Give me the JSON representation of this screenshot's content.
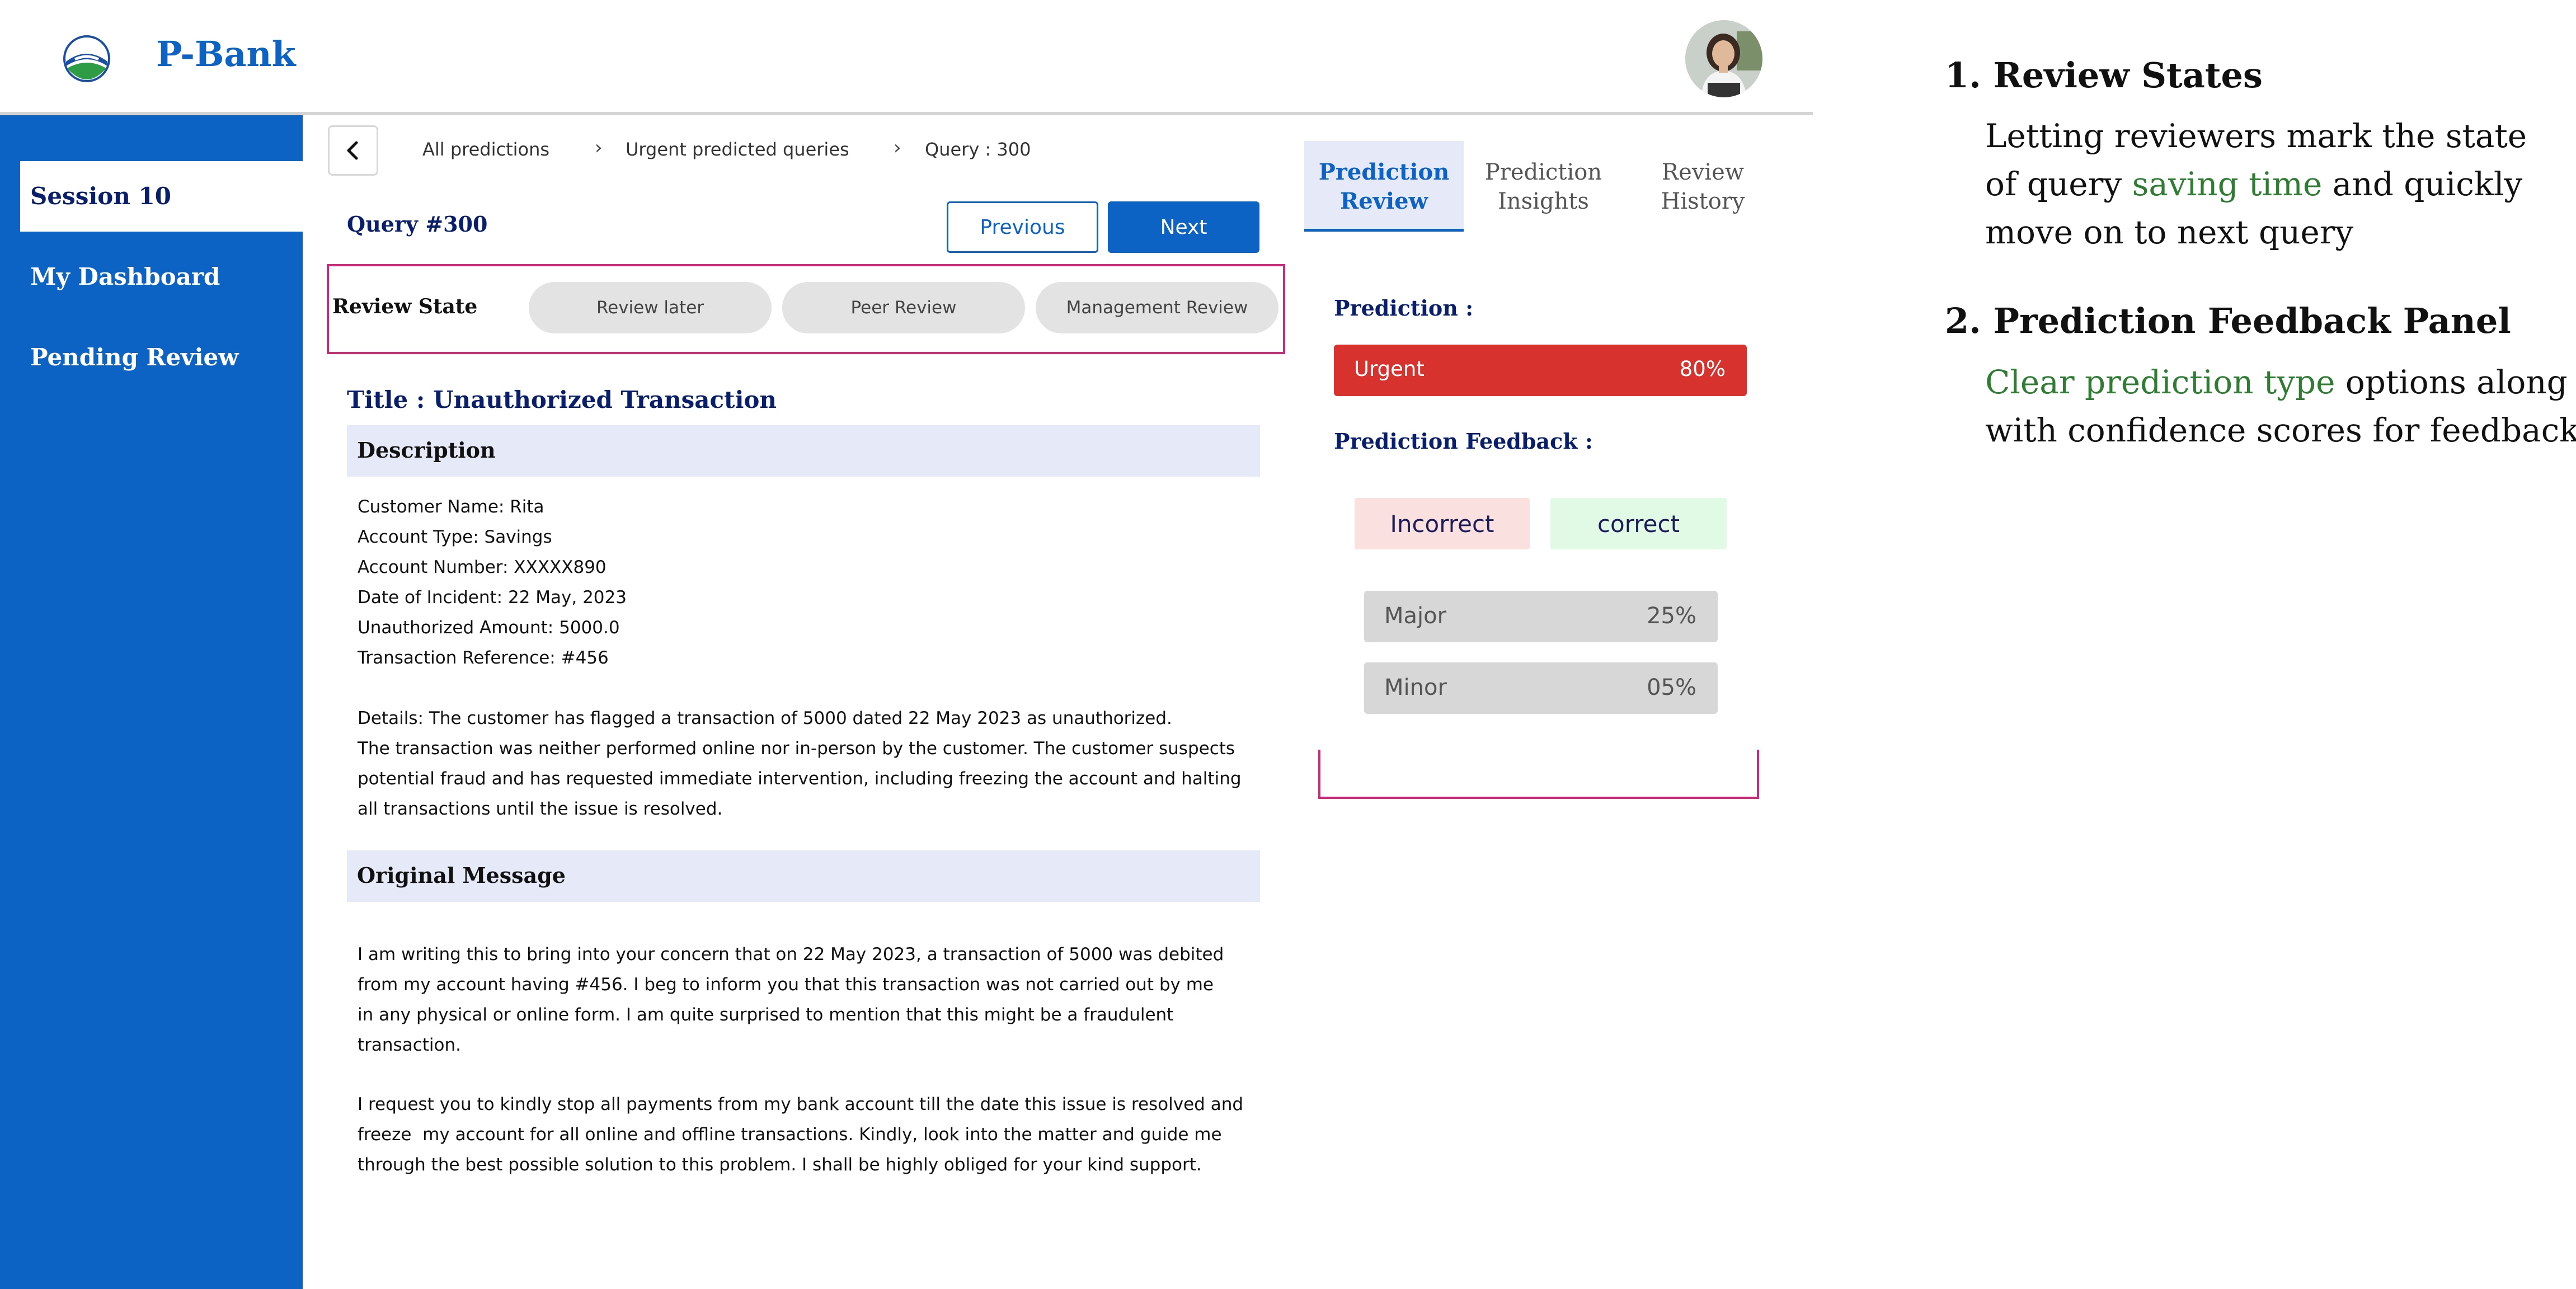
{
  "app": {
    "brand": "P-Bank"
  },
  "sidebar": {
    "items": [
      {
        "label": "Session 10"
      },
      {
        "label": "My Dashboard"
      },
      {
        "label": "Pending Review"
      }
    ]
  },
  "breadcrumb": [
    "All predictions",
    "Urgent predicted queries",
    "Query : 300"
  ],
  "query": {
    "title": "Query #300",
    "prev_label": "Previous",
    "next_label": "Next"
  },
  "review_state": {
    "label": "Review State",
    "options": [
      "Review later",
      "Peer Review",
      "Management Review"
    ]
  },
  "content": {
    "title": "Title : Unauthorized Transaction",
    "description_heading": "Description",
    "description_lines": [
      "Customer Name: Rita",
      "Account Type: Savings",
      "Account Number: XXXXX890",
      "Date of Incident: 22 May, 2023",
      "Unauthorized Amount: 5000.0",
      "Transaction Reference: #456"
    ],
    "details_lines": [
      "Details: The customer has flagged a transaction of 5000 dated 22 May 2023 as unauthorized.",
      "The transaction was neither performed online nor in-person by the customer. The customer suspects",
      "potential fraud and has requested immediate intervention, including freezing the account and halting",
      "all transactions until the issue is resolved."
    ],
    "original_heading": "Original Message",
    "original_lines": [
      "I am writing this to bring into your concern that on 22 May 2023, a transaction of 5000 was debited",
      "from my account having #456. I beg to inform you that this transaction was not carried out by me",
      "in any physical or online form. I am quite surprised to mention that this might be a fraudulent",
      "transaction."
    ],
    "original_lines_2": [
      "I request you to kindly stop all payments from my bank account till the date this issue is resolved and",
      "freeze  my account for all online and offline transactions. Kindly, look into the matter and guide me",
      "through the best possible solution to this problem. I shall be highly obliged for your kind support."
    ]
  },
  "panel": {
    "tabs": [
      {
        "line1": "Prediction",
        "line2": "Review"
      },
      {
        "line1": "Prediction",
        "line2": "Insights"
      },
      {
        "line1": "Review",
        "line2": "History"
      }
    ],
    "prediction_label": "Prediction :",
    "prediction": {
      "label": "Urgent",
      "value": "80%",
      "color": "#d7322d"
    },
    "feedback_label": "Prediction Feedback :",
    "incorrect_label": "Incorrect",
    "correct_label": "correct",
    "options": [
      {
        "label": "Major",
        "value": "25%"
      },
      {
        "label": "Minor",
        "value": "05%"
      }
    ]
  },
  "annotations": [
    {
      "number": "1.",
      "title": "Review States",
      "line1": "Letting reviewers mark the state",
      "line2_pre": "of query ",
      "line2_highlight": "saving time",
      "line2_post": " and quickly",
      "line3": "move on to next query"
    },
    {
      "number": "2.",
      "title": "Prediction Feedback Panel",
      "line1_highlight": "Clear prediction type",
      "line1_post": " options along",
      "line2": "with confidence scores for feedback"
    }
  ],
  "colors": {
    "primary": "#0d63c4",
    "navy": "#0a1f6b",
    "highlight_border": "#cc2a78",
    "accent_green": "#2e7d32"
  }
}
